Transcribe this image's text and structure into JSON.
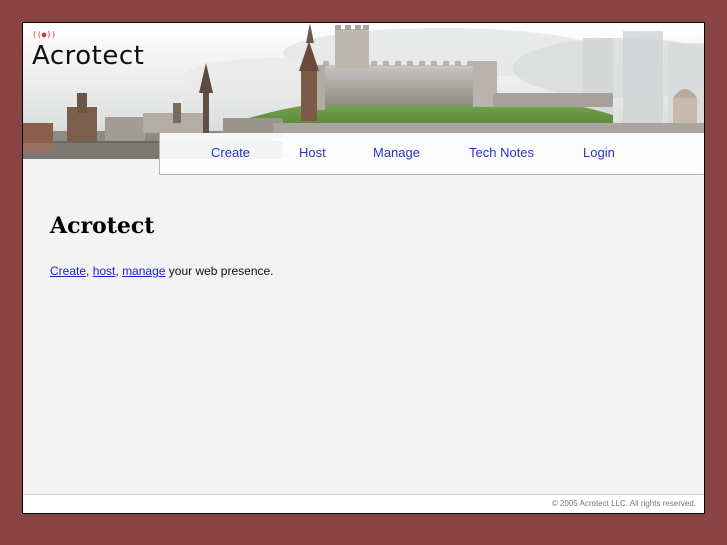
{
  "logo": {
    "signal_marks": "((●))",
    "wordmark": "Acrotect"
  },
  "nav": {
    "items": [
      {
        "label": "Create"
      },
      {
        "label": "Host"
      },
      {
        "label": "Manage"
      },
      {
        "label": "Tech Notes"
      },
      {
        "label": "Login"
      }
    ]
  },
  "main": {
    "title": "Acrotect",
    "tagline": {
      "link1": "Create",
      "sep1": ", ",
      "link2": "host",
      "sep2": ", ",
      "link3": "manage",
      "rest": " your web presence."
    }
  },
  "footer": {
    "copyright": "© 2005 Acrotect LLC. All rights reserved."
  },
  "colors": {
    "page_background": "#8a4446",
    "content_background": "#f3f3f3",
    "link": "#2a33c8",
    "banner_grass": "#6a9a46"
  }
}
